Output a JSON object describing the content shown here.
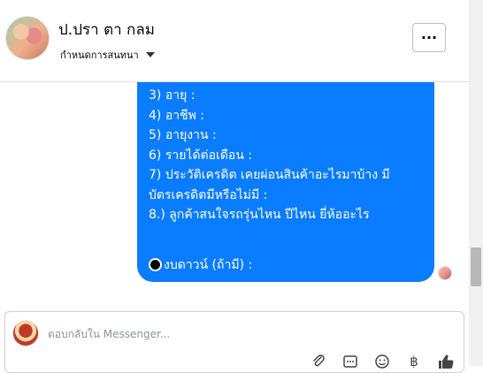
{
  "header": {
    "name": "ป.ปรา ตา กลม",
    "subtitle": "กำหนดการสนทนา",
    "more_label": "···"
  },
  "message": {
    "lines": [
      "3) อายุ :",
      "4) อาชีพ :",
      "5) อายุงาน :",
      "6) รายได้ต่อเดือน :",
      "7) ประวัติเครดิต  เคยผ่อนสินค้าอะไรมาบ้าง มี",
      "บัตรเครดิตมีหรือไม่มี :",
      "8.) ลูกค้าสนใจรถรุ่นไหน ปีไหน ยี่ห้ออะไร"
    ],
    "last_line": "งบดาวน์ (ถ้ามี) :"
  },
  "composer": {
    "placeholder": "ตอบกลับใน Messenger..."
  },
  "colors": {
    "bubble": "#0a7cff",
    "text": "#050505"
  },
  "icons": [
    "attachment-icon",
    "gif-icon",
    "emoji-icon",
    "baht-icon",
    "like-icon"
  ]
}
